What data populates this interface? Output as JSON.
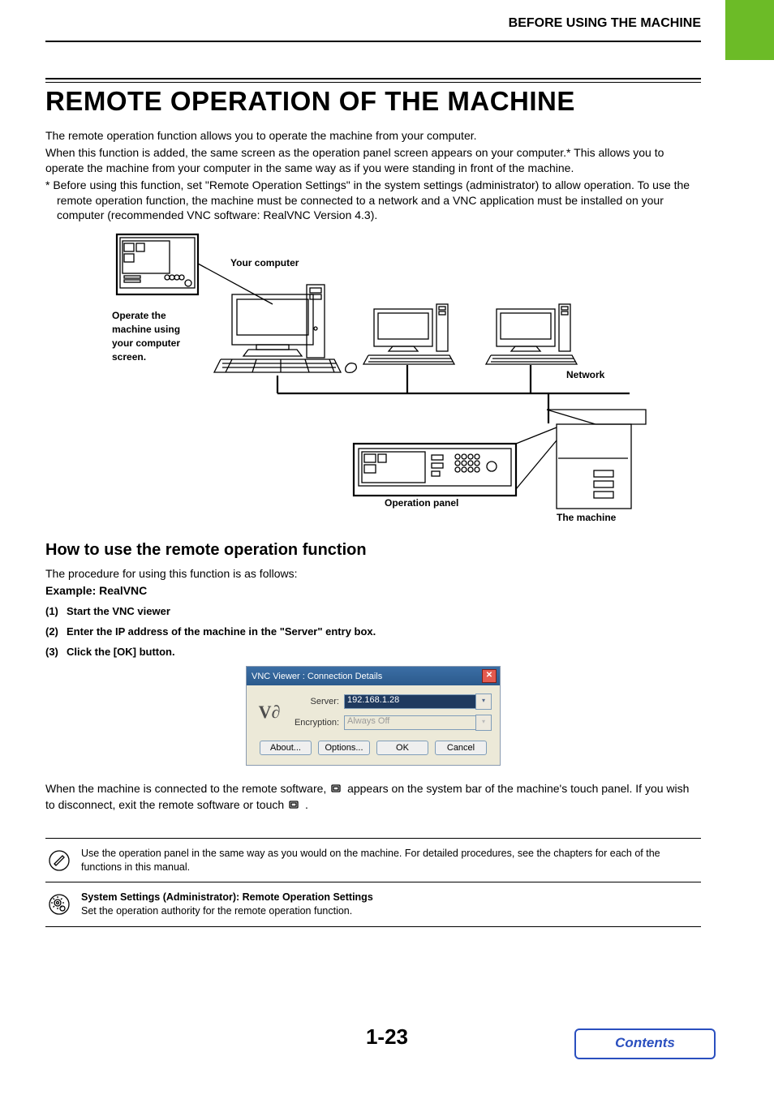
{
  "header": "BEFORE USING THE MACHINE",
  "title": "REMOTE OPERATION OF THE MACHINE",
  "intro1": "The remote operation function allows you to operate the machine from your computer.",
  "intro2": "When this function is added, the same screen as the operation panel screen appears on your computer.* This allows you to operate the machine from your computer in the same way as if you were standing in front of the machine.",
  "note": "*  Before using this function, set \"Remote Operation Settings\" in the system settings (administrator) to allow operation. To use the remote operation function, the machine must be connected to a network and a VNC application must be installed on your computer (recommended VNC software: RealVNC Version 4.3).",
  "diagram": {
    "your_computer": "Your computer",
    "operate_msg": "Operate the machine using your computer screen.",
    "network": "Network",
    "operation_panel": "Operation panel",
    "the_machine": "The machine"
  },
  "howto_heading": "How to use the remote operation function",
  "howto_intro": "The procedure for using this function is as follows:",
  "howto_example": "Example: RealVNC",
  "steps": {
    "s1": "Start the VNC viewer",
    "s2": "Enter the IP address of the machine in the \"Server\" entry box.",
    "s3": "Click the [OK] button."
  },
  "dialog": {
    "title": "VNC Viewer : Connection Details",
    "logo": "V∂",
    "server_label": "Server:",
    "server_value": "192.168.1.28",
    "encryption_label": "Encryption:",
    "encryption_value": "Always Off",
    "about": "About...",
    "options": "Options...",
    "ok": "OK",
    "cancel": "Cancel"
  },
  "after": {
    "p1a": "When the machine is connected to the remote software, ",
    "p1b": " appears on the system bar of the machine's touch panel. If you wish to disconnect, exit the remote software or touch ",
    "p1c": " ."
  },
  "info1": "Use the operation panel in the same way as you would on the machine. For detailed procedures, see the chapters for each of the functions in this manual.",
  "info2_title": "System Settings (Administrator): Remote Operation Settings",
  "info2_body": "Set the operation authority for the remote operation function.",
  "pagenum": "1-23",
  "contents": "Contents"
}
